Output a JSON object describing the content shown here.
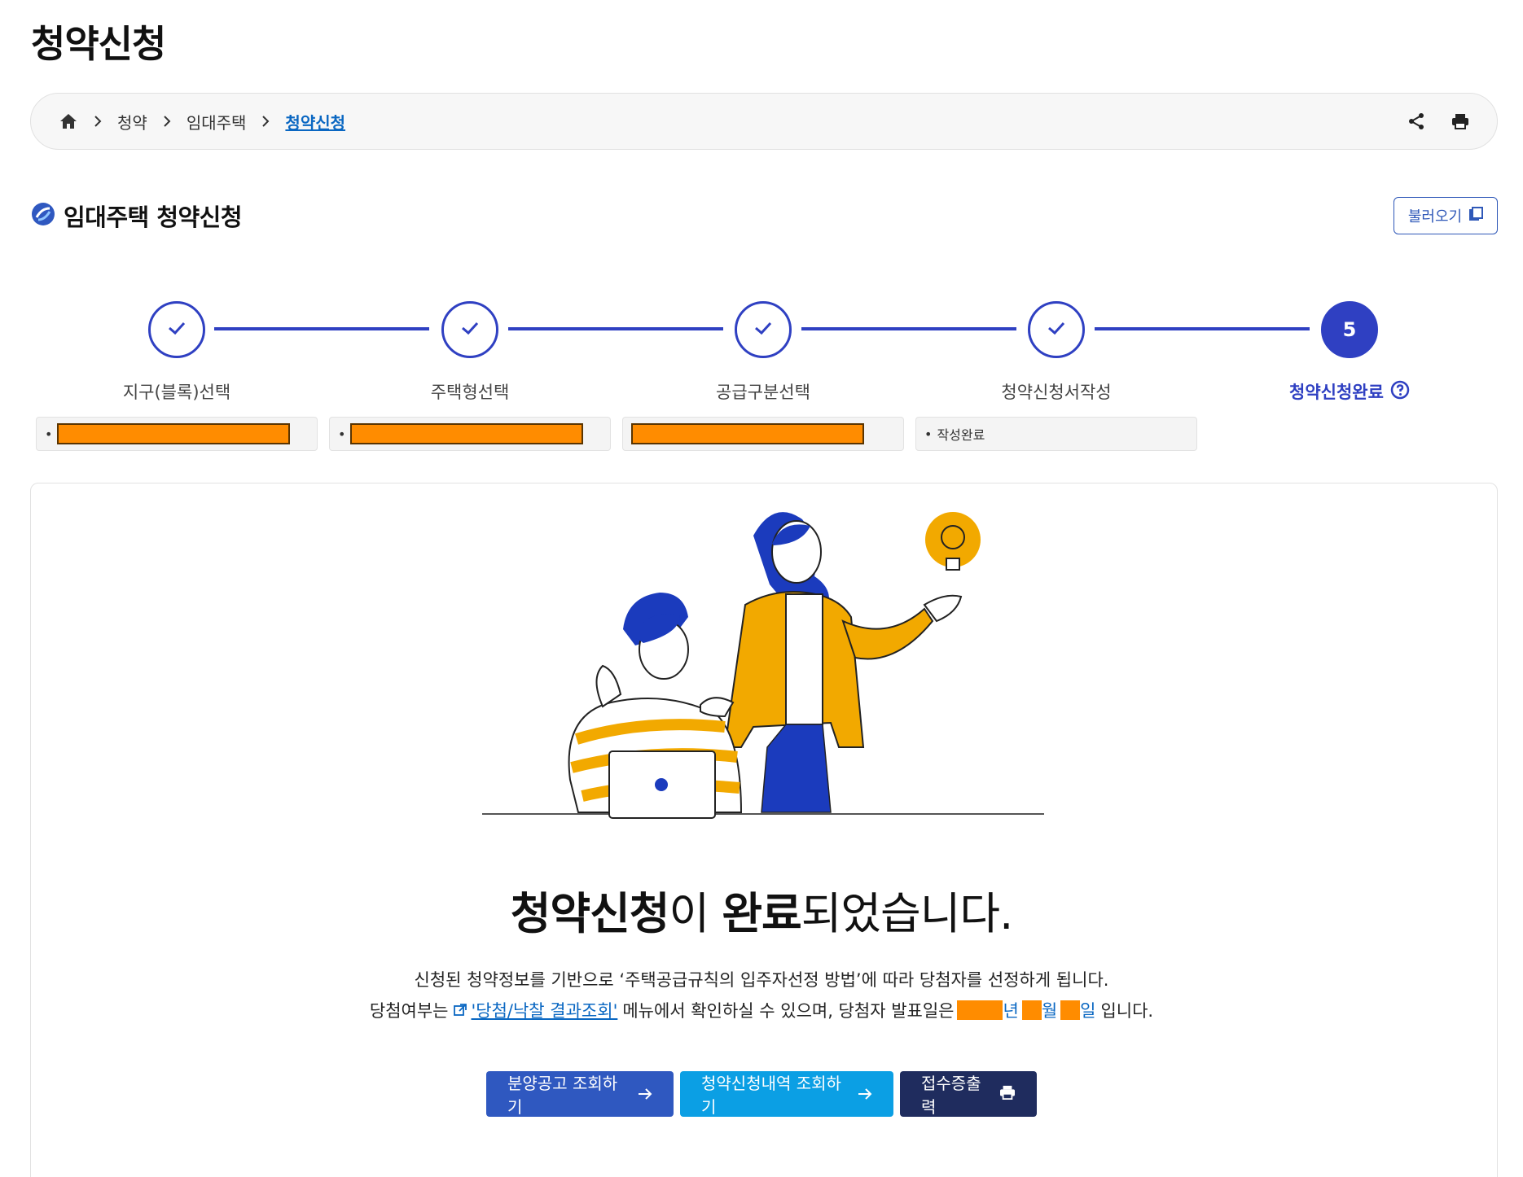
{
  "page": {
    "title": "청약신청"
  },
  "breadcrumb": {
    "items": [
      "청약",
      "임대주택"
    ],
    "current": "청약신청",
    "tools": [
      "share-icon",
      "print-icon"
    ]
  },
  "section": {
    "title": "임대주택 청약신청",
    "load_label": "불러오기"
  },
  "steps": [
    {
      "number": "1",
      "label": "지구(블록)선택",
      "status": "done",
      "value": ""
    },
    {
      "number": "2",
      "label": "주택형선택",
      "status": "done",
      "value": ""
    },
    {
      "number": "3",
      "label": "공급구분선택",
      "status": "done",
      "value": ""
    },
    {
      "number": "4",
      "label": "청약신청서작성",
      "status": "done",
      "value": "작성완료"
    },
    {
      "number": "5",
      "label": "청약신청완료",
      "status": "active"
    }
  ],
  "result": {
    "headline_a": "청약신청",
    "headline_b": "이 ",
    "headline_c": "완료",
    "headline_d": "되었습니다.",
    "desc_line1": "신청된 청약정보를 기반으로 ‘주택공급규칙의 입주자선정 방법’에 따라 당첨자를 선정하게 됩니다.",
    "desc_line2_pre": "당첨여부는",
    "desc_link": "'당첨/낙찰 결과조회'",
    "desc_line2_mid": "메뉴에서 확인하실 수 있으며, 당첨자 발표일은",
    "year_suffix": "년",
    "month_suffix": "월",
    "day_suffix": "일",
    "desc_line2_end": "입니다."
  },
  "buttons": {
    "notice": "분양공고 조회하기",
    "history": "청약신청내역 조회하기",
    "receipt": "접수증출력"
  },
  "colors": {
    "primary": "#2f40c2",
    "link": "#0a67c2",
    "redaction": "#ff8c00",
    "btn_notice": "#2f58c0",
    "btn_history": "#0b9fe4",
    "btn_receipt": "#1f2c5e"
  }
}
